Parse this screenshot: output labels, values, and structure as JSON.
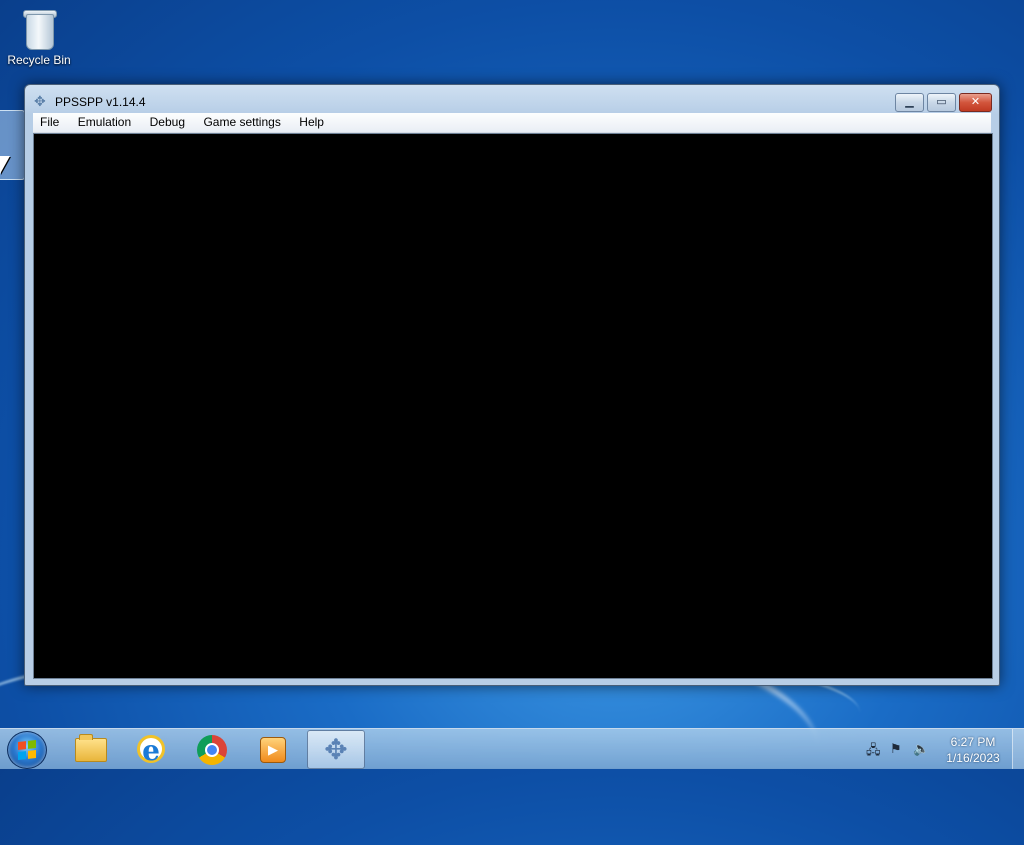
{
  "desktop": {
    "icons": [
      {
        "label": "Recycle Bin",
        "icon": "recycle-bin-icon"
      }
    ]
  },
  "window": {
    "title": "PPSSPP v1.14.4",
    "icon": "ppsspp-icon",
    "controls": {
      "minimize": "minimize",
      "maximize": "maximize",
      "close": "close"
    },
    "menu": [
      "File",
      "Emulation",
      "Debug",
      "Game settings",
      "Help"
    ]
  },
  "taskbar": {
    "start": "start-button",
    "pinned": [
      {
        "name": "file-explorer-icon"
      },
      {
        "name": "internet-explorer-icon"
      },
      {
        "name": "chrome-icon"
      },
      {
        "name": "media-player-icon"
      },
      {
        "name": "ppsspp-icon",
        "active": true
      }
    ],
    "tray": {
      "icons": [
        "network-icon",
        "flag-icon",
        "volume-icon"
      ]
    },
    "clock": {
      "time": "6:27 PM",
      "date": "1/16/2023"
    }
  }
}
